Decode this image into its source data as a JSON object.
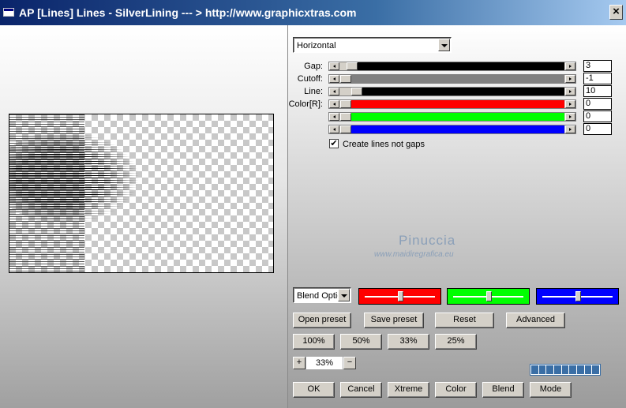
{
  "window": {
    "title": "AP [Lines]  Lines - SilverLining    --- > http://www.graphicxtras.com"
  },
  "orientation": {
    "selected": "Horizontal"
  },
  "sliders": [
    {
      "label": "Gap:",
      "value": "3",
      "fraction": 0.03,
      "color": "#000000"
    },
    {
      "label": "Cutoff:",
      "value": "-1",
      "fraction": 0.0,
      "color": "#808080"
    },
    {
      "label": "Line:",
      "value": "10",
      "fraction": 0.05,
      "color": "#000000"
    },
    {
      "label": "Color[R]:",
      "value": "0",
      "fraction": 0.0,
      "color": "#ff0000"
    },
    {
      "label": "",
      "value": "0",
      "fraction": 0.0,
      "color": "#00ff00"
    },
    {
      "label": "",
      "value": "0",
      "fraction": 0.0,
      "color": "#0000ff"
    }
  ],
  "checkbox": {
    "label": "Create lines not gaps",
    "checked": true,
    "mark": "✔"
  },
  "watermark": {
    "name": "Pinuccia",
    "site": "www.maidiregrafica.eu"
  },
  "blend": {
    "selected": "Blend Optio"
  },
  "color_boxes": [
    {
      "color": "#ff0000",
      "level": 0.5
    },
    {
      "color": "#00ff00",
      "level": 0.5
    },
    {
      "color": "#0000ff",
      "level": 0.5
    }
  ],
  "preset_buttons": {
    "open": "Open preset",
    "save": "Save preset",
    "reset": "Reset",
    "advanced": "Advanced"
  },
  "zoom_buttons": [
    "100%",
    "50%",
    "33%",
    "25%"
  ],
  "zoom": {
    "plus": "+",
    "value": "33%",
    "minus": "−"
  },
  "bottom_buttons": [
    "OK",
    "Cancel",
    "Xtreme",
    "Color",
    "Blend",
    "Mode"
  ],
  "progress": {
    "segments": 9,
    "filled": 9
  }
}
